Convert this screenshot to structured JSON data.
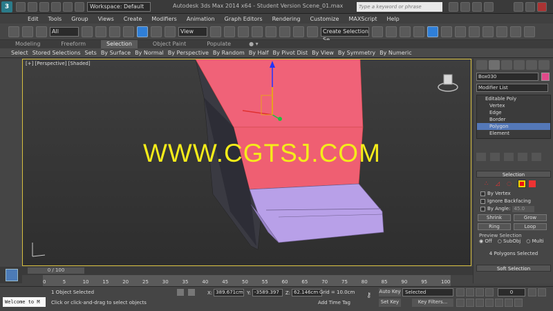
{
  "titlebar": {
    "workspace": "Workspace: Default",
    "title": "Autodesk 3ds Max 2014 x64 - Student Version    Scene_01.max",
    "search_placeholder": "Type a keyword or phrase"
  },
  "menu": [
    "Edit",
    "Tools",
    "Group",
    "Views",
    "Create",
    "Modifiers",
    "Animation",
    "Graph Editors",
    "Rendering",
    "Customize",
    "MAXScript",
    "Help"
  ],
  "toolbar": {
    "filter": "All",
    "ref_coord": "View",
    "named_selection": "Create Selection Se"
  },
  "ribbon": {
    "tabs": [
      "Modeling",
      "Freeform",
      "Selection",
      "Object Paint",
      "Populate"
    ],
    "active_tab": "Selection",
    "sub_items": [
      "Select",
      "Stored Selections",
      "Sets",
      "By Surface",
      "By Normal",
      "By Perspective",
      "By Random",
      "By Half",
      "By Pivot Dist",
      "By View",
      "By Symmetry",
      "By Numeric"
    ]
  },
  "viewport": {
    "label": "[+] [Perspective] [Shaded]",
    "watermark": "WWW.CGTSJ.COM"
  },
  "command_panel": {
    "object_name": "Box030",
    "modifier_list": "Modifier List",
    "stack": {
      "top": "Editable Poly",
      "items": [
        "Vertex",
        "Edge",
        "Border",
        "Polygon",
        "Element"
      ],
      "selected": "Polygon"
    },
    "selection_rollout": {
      "title": "Selection",
      "by_vertex": "By Vertex",
      "ignore_backfacing": "Ignore Backfacing",
      "by_angle": "By Angle:",
      "angle_value": "45.0",
      "shrink": "Shrink",
      "grow": "Grow",
      "ring": "Ring",
      "loop": "Loop",
      "preview_title": "Preview Selection",
      "preview_options": [
        "Off",
        "SubObj",
        "Multi"
      ],
      "status": "4 Polygons Selected"
    },
    "soft_selection": "Soft Selection"
  },
  "timeline": {
    "slider": "0 / 100",
    "ticks": [
      "0",
      "5",
      "10",
      "15",
      "20",
      "25",
      "30",
      "35",
      "40",
      "45",
      "50",
      "55",
      "60",
      "65",
      "70",
      "75",
      "80",
      "85",
      "90",
      "95",
      "100"
    ]
  },
  "status": {
    "maxscript": "Welcome to M",
    "selection": "1 Object Selected",
    "prompt": "Click or click-and-drag to select objects",
    "x_label": "X:",
    "x": "389.671cm",
    "y_label": "Y:",
    "y": "-3589.397",
    "z_label": "Z:",
    "z": "62.146cm",
    "grid": "Grid = 10.0cm",
    "add_time_tag": "Add Time Tag",
    "auto_key": "Auto Key",
    "set_key": "Set Key",
    "key_mode": "Selected",
    "key_filters": "Key Filters...",
    "frame": "0"
  },
  "colors": {
    "accent_blue": "#2f7fd8",
    "viewport_border": "#d8c040",
    "watermark": "#f5ec1a",
    "object_pink": "#f06278",
    "object_purple": "#b8a0e8"
  }
}
